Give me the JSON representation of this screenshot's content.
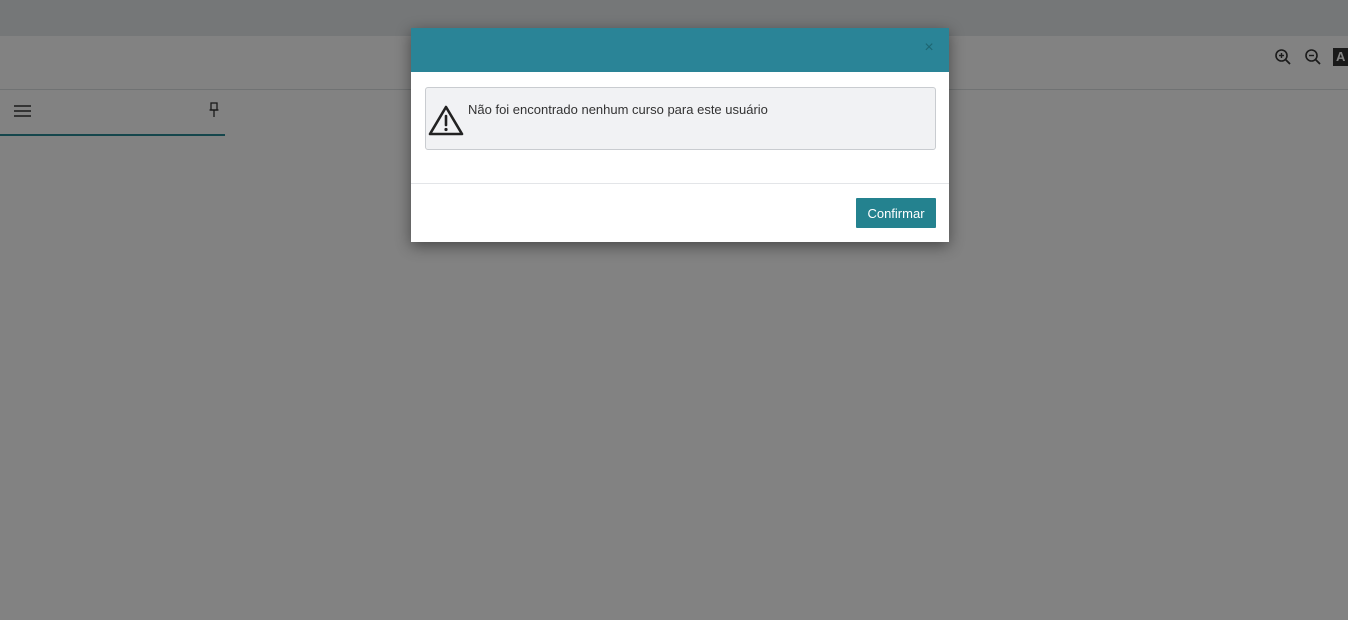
{
  "header": {
    "tools": [
      {
        "icon": "zoom-in-icon"
      },
      {
        "icon": "zoom-out-icon"
      },
      {
        "icon": "font-size-icon",
        "glyph": "A"
      }
    ]
  },
  "sidebar": {
    "menu_icon": "menu-icon",
    "pin_icon": "pin-icon"
  },
  "modal": {
    "close_label": "×",
    "message": "Não foi encontrado nenhum curso para este usuário",
    "confirm_label": "Confirmar",
    "header_color": "#2a8497",
    "button_color": "#24828f",
    "icon": "warning-icon"
  }
}
